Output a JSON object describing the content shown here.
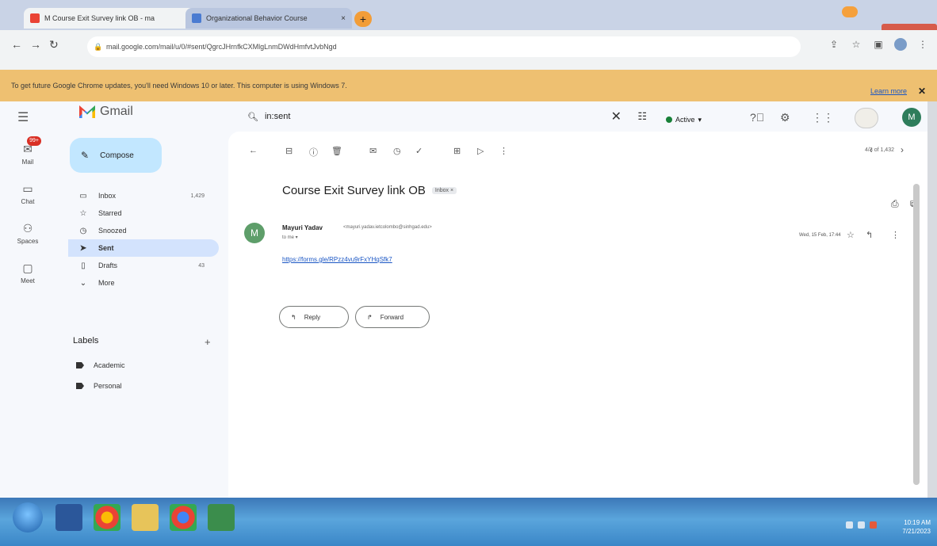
{
  "browser": {
    "tabs": [
      {
        "label": "M  Course Exit Survey link OB - ma",
        "close": "×"
      },
      {
        "label": "Organizational Behavior Course",
        "close": "×"
      }
    ],
    "new_tab": "+",
    "url": "mail.google.com/mail/u/0/#sent/QgrcJHrnfkCXMlgLnmDWdHmfvtJvbNgd",
    "infobar_text": "To get future Google Chrome updates, you'll need Windows 10 or later. This computer is using Windows 7.",
    "infobar_link": "Learn more",
    "infobar_close": "✕"
  },
  "gmail": {
    "brand": "Gmail",
    "compose": "Compose",
    "search_query": "in:sent",
    "status": "Active",
    "rail": [
      {
        "label": "Mail",
        "badge": "99+"
      },
      {
        "label": "Chat"
      },
      {
        "label": "Spaces"
      },
      {
        "label": "Meet"
      }
    ],
    "nav": [
      {
        "label": "Inbox",
        "count": "1,429",
        "icon": "inbox-icon"
      },
      {
        "label": "Starred",
        "count": "",
        "icon": "star-icon"
      },
      {
        "label": "Snoozed",
        "count": "",
        "icon": "clock-icon"
      },
      {
        "label": "Sent",
        "count": "",
        "icon": "send-icon"
      },
      {
        "label": "Drafts",
        "count": "43",
        "icon": "draft-icon"
      },
      {
        "label": "More",
        "count": "",
        "icon": "chevron-down-icon"
      }
    ],
    "labels_title": "Labels",
    "labels": [
      "Academic",
      "Personal"
    ],
    "pager": "4/3 of 1,432",
    "avatar_letter": "M"
  },
  "message": {
    "subject": "Course Exit Survey link OB",
    "chip": "Inbox ×",
    "sender_name": "Mayuri Yadav",
    "sender_email": "<mayuri.yadav.ietcolombo@sinhgad.edu>",
    "to": "to me ▾",
    "date": "Wed, 15 Feb, 17:44",
    "link": "https://forms.gle/RPzz4vu9rFxYHqSfk7",
    "avatar_letter": "M",
    "reply": "Reply",
    "forward": "Forward"
  },
  "taskbar": {
    "time": "10:19 AM",
    "date": "7/21/2023"
  },
  "colors": {
    "infobar": "#eec071",
    "compose": "#c2e7ff",
    "selected_nav": "#d3e3fd",
    "link": "#1a56c4"
  }
}
